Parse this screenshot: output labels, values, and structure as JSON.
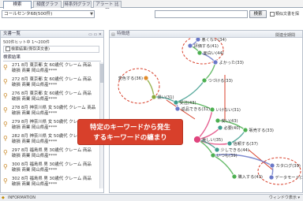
{
  "tabs": [
    {
      "label": "検索",
      "active": true
    },
    {
      "label": "頻度グラフ",
      "active": false
    },
    {
      "label": "時系列グラフ",
      "active": false
    },
    {
      "label": "アラート 比較",
      "active": false
    }
  ],
  "toolbar": {
    "query_value": "コールセンタ68(500件)",
    "search_value": "",
    "search_button": "検索",
    "similar_label": "類似文書を探"
  },
  "left_panel": {
    "header": "文書一覧",
    "header_icons": "▭ ▭ ✕",
    "hit_count": "500件ヒット中 1～200件",
    "saved_row": "検索結果(保存済文書)",
    "section_label": "検索結果",
    "results": [
      {
        "line1": "271 8月 東京都 女 60歳代 クレーム 商品",
        "line2": "破損 商業 岡山県産****"
      },
      {
        "line1": "272 8月 東京都 女 60歳代 クレーム 商品",
        "line2": "破損 商業 岡山県産****"
      },
      {
        "line1": "276 8月 東京都 女 60歳代 クレーム 商品",
        "line2": "破損 商業 岡山県産****"
      },
      {
        "line1": "278 8月 神奈川県 女 50歳代 クレーム 商品",
        "line2": "破損 商業 岡山県産****"
      },
      {
        "line1": "279 8月 神奈川県 女 50歳代 クレーム 商品",
        "line2": "破損 商業 岡山県産****"
      },
      {
        "line1": "282 8月 神奈川県 女 50歳代 クレーム 商品",
        "line2": "破損 商業 岡山県産****"
      },
      {
        "line1": "297 8月 福島県 男 30歳代 クレーム 商品",
        "line2": "破損 商業 岡山県産****"
      },
      {
        "line1": "300 8月 福島県 男 30歳代 クレーム 商品",
        "line2": "破損 商業 岡山県産****"
      },
      {
        "line1": "302 8月 福島県 男 30歳代 クレーム 商品",
        "line2": "破損 商業 岡山県産****"
      }
    ]
  },
  "right_panel": {
    "header": "特徴語",
    "period": "関連全期間"
  },
  "graph": {
    "nodes": [
      {
        "id": "n_warui",
        "label": "悪くない(34)",
        "color": "#6a78c8"
      },
      {
        "id": "n_hyouka",
        "label": "評価する(41)",
        "color": "#6a78c8"
      },
      {
        "id": "n_omoshiroi",
        "label": "面白い(44)",
        "color": "#4caf50"
      },
      {
        "id": "n_yokatta",
        "label": "よかった(33)",
        "color": "#6a78c8"
      },
      {
        "id": "n_tsuzukeru",
        "label": "つづける(33)",
        "color": "#4caf50"
      },
      {
        "id": "n_henshoku",
        "label": "変色する(36)",
        "color": "#e08a2a"
      },
      {
        "id": "n_kuroi",
        "label": "黒い(31)",
        "color": "#8aa83a"
      },
      {
        "id": "n_shuyo",
        "label": "受注(43)",
        "color": "#3c9b8c"
      },
      {
        "id": "n_henpin",
        "label": "返品できる(31)",
        "color": "#6a78c8"
      },
      {
        "id": "n_ikenai",
        "label": "いけない(31)",
        "color": "#4caf50"
      },
      {
        "id": "n_hitsuyo",
        "label": "必要(40)",
        "color": "#3c9b8c"
      },
      {
        "id": "n_yasui",
        "label": "安い(43)",
        "color": "#4caf50"
      },
      {
        "id": "n_hanbai",
        "label": "販売する(33)",
        "color": "#4caf50"
      },
      {
        "id": "n_shinrai",
        "label": "信頼する(37)",
        "color": "#3c9b8c"
      },
      {
        "id": "n_center",
        "label": "美しい(35)",
        "color": "#e0457e"
      },
      {
        "id": "n_sukoshi",
        "label": "少しできる(44)",
        "color": "#3c9b8c"
      },
      {
        "id": "n_itsumo",
        "label": "いつも(39)",
        "color": "#4caf50"
      },
      {
        "id": "n_catalog",
        "label": "カタログ(39)",
        "color": "#6a78c8"
      },
      {
        "id": "n_datamodel",
        "label": "データモード(34)",
        "color": "#6a78c8"
      },
      {
        "id": "n_kounyu",
        "label": "購入する(43)",
        "color": "#4caf50"
      }
    ],
    "edges": [
      [
        "n_warui",
        "n_hyouka"
      ],
      [
        "n_hyouka",
        "n_omoshiroi"
      ],
      [
        "n_omoshiroi",
        "n_yokatta"
      ],
      [
        "n_yokatta",
        "n_tsuzukeru"
      ],
      [
        "n_tsuzukeru",
        "n_shuyo"
      ],
      [
        "n_henshoku",
        "n_kuroi"
      ],
      [
        "n_kuroi",
        "n_shuyo"
      ],
      [
        "n_shuyo",
        "n_henpin"
      ],
      [
        "n_shuyo",
        "n_ikenai"
      ],
      [
        "n_ikenai",
        "n_center"
      ],
      [
        "n_hitsuyo",
        "n_center"
      ],
      [
        "n_yasui",
        "n_hanbai"
      ],
      [
        "n_hanbai",
        "n_shinrai"
      ],
      [
        "n_shinrai",
        "n_center"
      ],
      [
        "n_center",
        "n_sukoshi"
      ],
      [
        "n_center",
        "n_itsumo"
      ],
      [
        "n_itsumo",
        "n_kounyu"
      ],
      [
        "n_itsumo",
        "n_catalog"
      ],
      [
        "n_catalog",
        "n_datamodel"
      ]
    ]
  },
  "annotation": {
    "line1": "特定のキーワードから発生",
    "line2": "するキーワードの纏まり",
    "color": "#d8402b"
  },
  "statusbar": {
    "info": "INFORMATION",
    "right": "ウィンドウ表示 ▾"
  }
}
